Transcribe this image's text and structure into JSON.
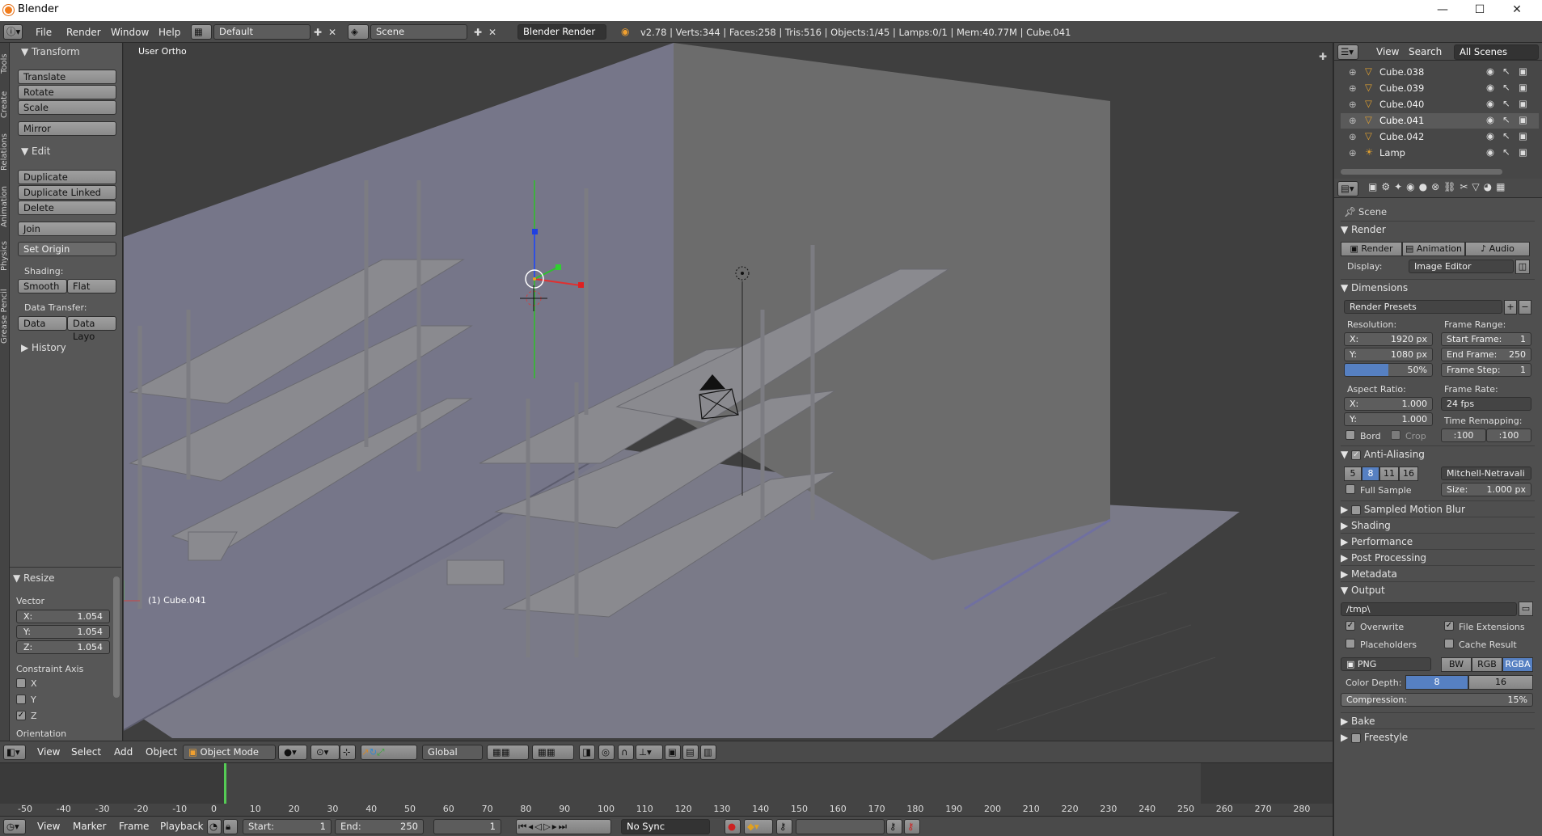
{
  "window": {
    "title": "Blender",
    "minimize": "—",
    "maximize": "☐",
    "close": "✕"
  },
  "info": {
    "menus": [
      "File",
      "Render",
      "Window",
      "Help"
    ],
    "layout": "Default",
    "scene": "Scene",
    "engine": "Blender Render",
    "stats": "v2.78 | Verts:344 | Faces:258 | Tris:516 | Objects:1/45 | Lamps:0/1 | Mem:40.77M | Cube.041"
  },
  "left_tabs": [
    "Tools",
    "Create",
    "Relations",
    "Animation",
    "Physics",
    "Grease Pencil"
  ],
  "toolshelf": {
    "transform_header": "Transform",
    "transform": [
      "Translate",
      "Rotate",
      "Scale"
    ],
    "mirror": "Mirror",
    "edit_header": "Edit",
    "edit": [
      "Duplicate",
      "Duplicate Linked",
      "Delete"
    ],
    "join": "Join",
    "set_origin": "Set Origin",
    "shading_label": "Shading:",
    "smooth": "Smooth",
    "flat": "Flat",
    "data_transfer_label": "Data Transfer:",
    "data": "Data",
    "data_layo": "Data Layo",
    "history": "History"
  },
  "operator": {
    "header": "Resize",
    "vector_label": "Vector",
    "x": "X:",
    "xv": "1.054",
    "y": "Y:",
    "yv": "1.054",
    "z": "Z:",
    "zv": "1.054",
    "constraint_label": "Constraint Axis",
    "cx": "X",
    "cy": "Y",
    "cz": "Z",
    "orientation": "Orientation"
  },
  "viewport": {
    "view_name": "User Ortho",
    "object_name": "(1) Cube.041"
  },
  "view3d_header": {
    "menus": [
      "View",
      "Select",
      "Add",
      "Object"
    ],
    "mode": "Object Mode",
    "orientation": "Global"
  },
  "timeline": {
    "ticks": [
      "-50",
      "-40",
      "-30",
      "-20",
      "-10",
      "0",
      "10",
      "20",
      "30",
      "40",
      "50",
      "60",
      "70",
      "80",
      "90",
      "100",
      "110",
      "120",
      "130",
      "140",
      "150",
      "160",
      "170",
      "180",
      "190",
      "200",
      "210",
      "220",
      "230",
      "240",
      "250",
      "260",
      "270",
      "280"
    ],
    "current_frame": 0
  },
  "timeline_header": {
    "menus": [
      "View",
      "Marker",
      "Frame",
      "Playback"
    ],
    "start_label": "Start:",
    "start": "1",
    "end_label": "End:",
    "end": "250",
    "current": "1",
    "sync": "No Sync"
  },
  "outliner": {
    "view": "View",
    "search": "Search",
    "filter": "All Scenes",
    "items": [
      "Cube.038",
      "Cube.039",
      "Cube.040",
      "Cube.041",
      "Cube.042",
      "Lamp"
    ]
  },
  "properties": {
    "context": "Scene",
    "render_header": "Render",
    "render_btn": "Render",
    "animation_btn": "Animation",
    "audio_btn": "Audio",
    "display_label": "Display:",
    "display": "Image Editor",
    "dimensions_header": "Dimensions",
    "render_presets": "Render Presets",
    "resolution_label": "Resolution:",
    "res_x": "X:",
    "res_x_v": "1920 px",
    "res_y": "Y:",
    "res_y_v": "1080 px",
    "res_pct": "50%",
    "aspect_label": "Aspect Ratio:",
    "asp_x": "X:",
    "asp_x_v": "1.000",
    "asp_y": "Y:",
    "asp_y_v": "1.000",
    "bord": "Bord",
    "crop": "Crop",
    "frame_range_label": "Frame Range:",
    "start_frame": "Start Frame:",
    "start_frame_v": "1",
    "end_frame": "End Frame:",
    "end_frame_v": "250",
    "frame_step": "Frame Step:",
    "frame_step_v": "1",
    "frame_rate_label": "Frame Rate:",
    "frame_rate": "24 fps",
    "time_remap_label": "Time Remapping:",
    "remap_old": ":100",
    "remap_new": ":100",
    "aa_header": "Anti-Aliasing",
    "aa_samples": [
      "5",
      "8",
      "11",
      "16"
    ],
    "aa_filter": "Mitchell-Netravali",
    "full_sample": "Full Sample",
    "aa_size": "Size:",
    "aa_size_v": "1.000 px",
    "motion_blur": "Sampled Motion Blur",
    "shading": "Shading",
    "performance": "Performance",
    "post_processing": "Post Processing",
    "metadata": "Metadata",
    "output_header": "Output",
    "output_path": "/tmp\\",
    "overwrite": "Overwrite",
    "file_extensions": "File Extensions",
    "placeholders": "Placeholders",
    "cache_result": "Cache Result",
    "format": "PNG",
    "bw": "BW",
    "rgb": "RGB",
    "rgba": "RGBA",
    "color_depth_label": "Color Depth:",
    "depth8": "8",
    "depth16": "16",
    "compression": "Compression:",
    "compression_v": "15%",
    "bake": "Bake",
    "freestyle": "Freestyle"
  }
}
